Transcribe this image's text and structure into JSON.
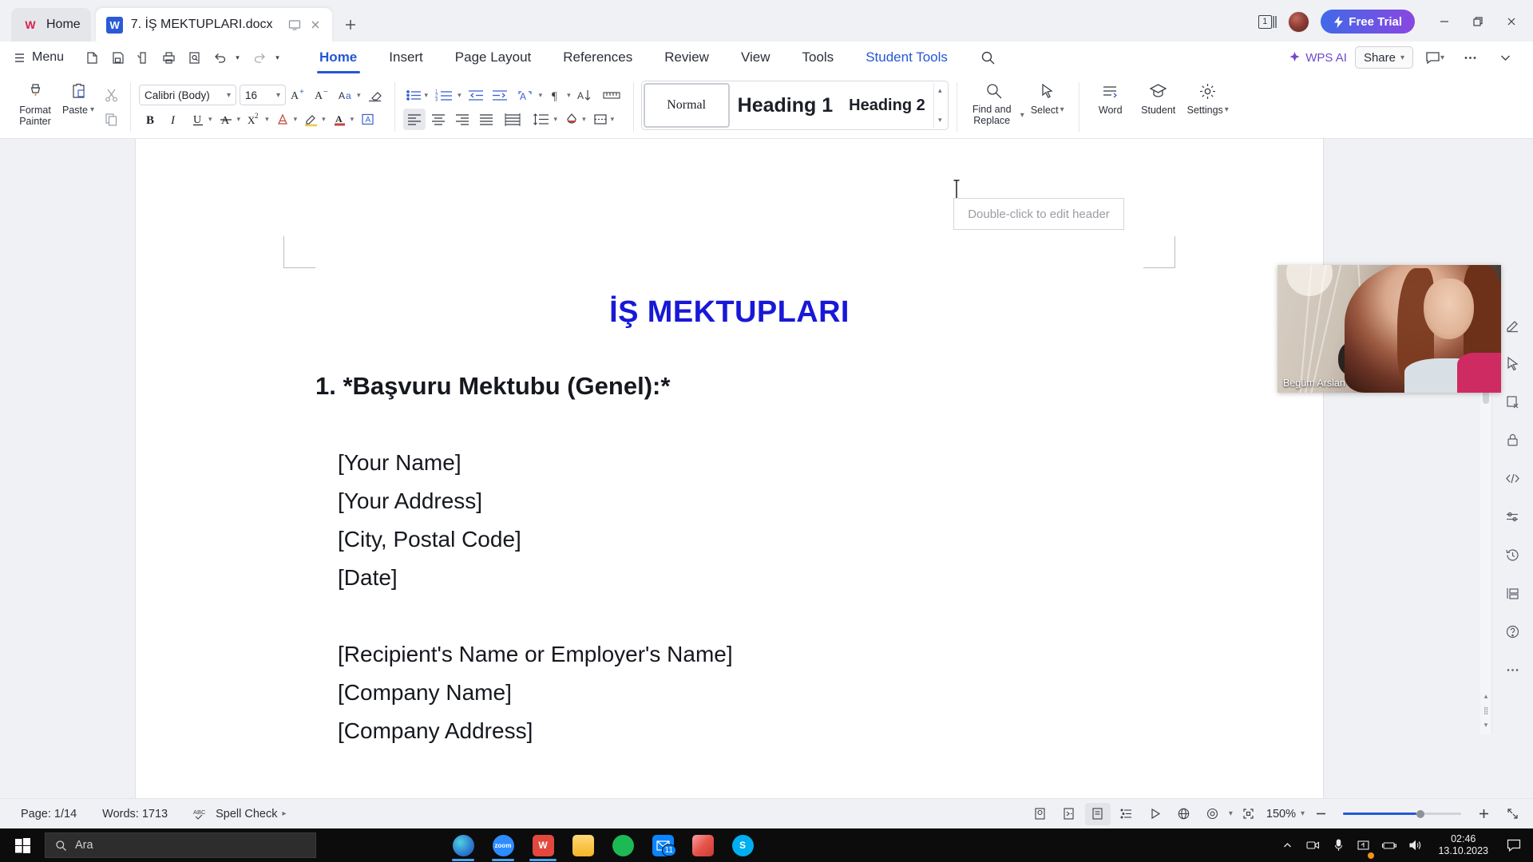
{
  "tabstrip": {
    "home_tab": "Home",
    "doc_tab": "7. İŞ MEKTUPLARI.docx",
    "new_tab_label": "+",
    "window_count": "1",
    "free_trial": "Free Trial"
  },
  "menubar": {
    "menu_label": "Menu",
    "quick_access": [
      "new-icon",
      "save-icon",
      "print-preview-icon",
      "print-icon",
      "find-icon",
      "undo-icon",
      "redo-icon",
      "customize-qat-icon"
    ],
    "tabs": [
      {
        "label": "Home",
        "active": true
      },
      {
        "label": "Insert",
        "active": false
      },
      {
        "label": "Page Layout",
        "active": false
      },
      {
        "label": "References",
        "active": false
      },
      {
        "label": "Review",
        "active": false
      },
      {
        "label": "View",
        "active": false
      },
      {
        "label": "Tools",
        "active": false
      },
      {
        "label": "Student Tools",
        "active": false
      }
    ],
    "wps_ai": "WPS AI",
    "share": "Share"
  },
  "ribbon": {
    "format_painter": "Format Painter",
    "paste": "Paste",
    "font_name": "Calibri (Body)",
    "font_size": "16",
    "styles": [
      {
        "label": "Normal",
        "kind": "normal"
      },
      {
        "label": "Heading 1",
        "kind": "h1"
      },
      {
        "label": "Heading 2",
        "kind": "h2"
      }
    ],
    "find_replace": "Find and Replace",
    "select": "Select",
    "word": "Word",
    "student": "Student",
    "settings": "Settings"
  },
  "document": {
    "header_hint": "Double-click to edit header",
    "title": "İŞ MEKTUPLARI",
    "title_color": "#1818d8",
    "heading": "1. *Başvuru Mektubu (Genel):*",
    "body": "[Your Name]\n[Your Address]\n[City, Postal Code]\n[Date]\n\n[Recipient's Name or Employer's Name]\n[Company Name]\n[Company Address]"
  },
  "webcam": {
    "participant_name": "Begüm Arslan"
  },
  "statusbar": {
    "page": "Page: 1/14",
    "words": "Words: 1713",
    "spell_check": "Spell Check",
    "zoom": "150%"
  },
  "taskbar": {
    "search_placeholder": "Ara",
    "apps": [
      {
        "name": "edge",
        "label": "e",
        "color": "#2f7fd1",
        "badge": null,
        "active": true
      },
      {
        "name": "zoom",
        "label": "zoom",
        "color": "#2d8cff",
        "badge": null,
        "active": true
      },
      {
        "name": "wps-office",
        "label": "W",
        "color": "#e2483d",
        "badge": null,
        "active": true
      },
      {
        "name": "file-explorer",
        "label": "",
        "color": "#ffc83d",
        "badge": null,
        "active": false
      },
      {
        "name": "spotify",
        "label": "",
        "color": "#1db954",
        "badge": null,
        "active": false
      },
      {
        "name": "mail",
        "label": "",
        "color": "#0a84ff",
        "badge": "11",
        "active": false
      },
      {
        "name": "microsoft-store",
        "label": "",
        "color": "#e8544c",
        "badge": null,
        "active": false
      },
      {
        "name": "skype",
        "label": "S",
        "color": "#00aff0",
        "badge": null,
        "active": false
      }
    ],
    "time": "02:46",
    "date": "13.10.2023"
  }
}
